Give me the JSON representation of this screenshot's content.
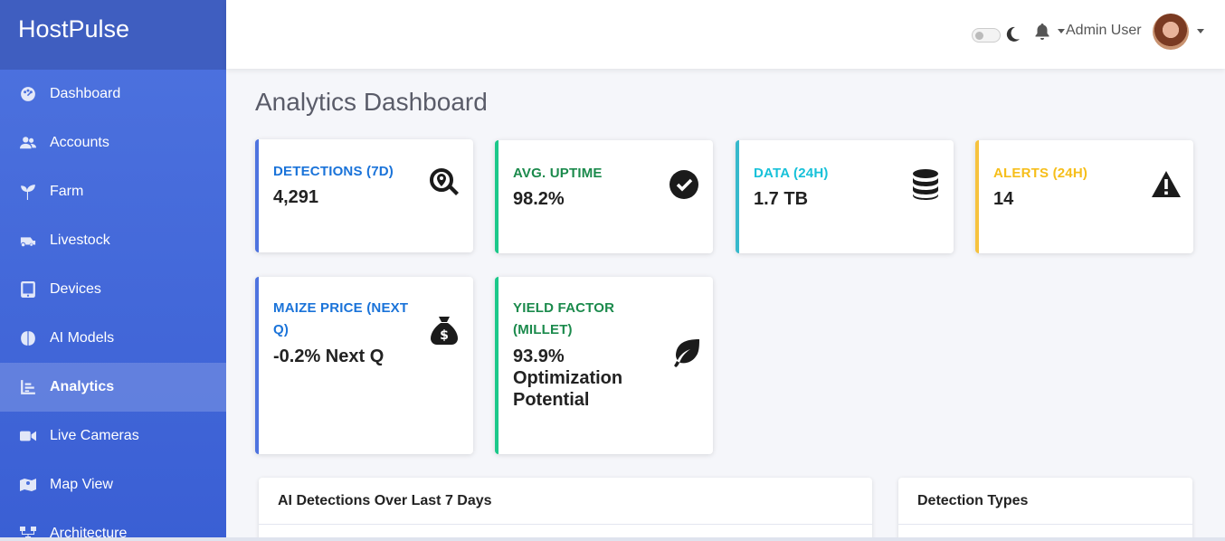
{
  "brand": {
    "name": "HostPulse"
  },
  "sidebar": {
    "items": [
      {
        "label": "Dashboard",
        "icon": "palette-icon",
        "active": false
      },
      {
        "label": "Accounts",
        "icon": "users-icon",
        "active": false
      },
      {
        "label": "Farm",
        "icon": "seedling-icon",
        "active": false
      },
      {
        "label": "Livestock",
        "icon": "tractor-icon",
        "active": false
      },
      {
        "label": "Devices",
        "icon": "tablet-icon",
        "active": false
      },
      {
        "label": "AI Models",
        "icon": "brain-icon",
        "active": false
      },
      {
        "label": "Analytics",
        "icon": "chart-icon",
        "active": true
      },
      {
        "label": "Live Cameras",
        "icon": "video-icon",
        "active": false
      },
      {
        "label": "Map View",
        "icon": "map-icon",
        "active": false
      },
      {
        "label": "Architecture",
        "icon": "sitemap-icon",
        "active": false
      }
    ]
  },
  "topbar": {
    "user_name": "Admin User"
  },
  "page": {
    "title": "Analytics Dashboard"
  },
  "cards": [
    {
      "label": "DETECTIONS (7D)",
      "value": "4,291",
      "color": "#1a73d9",
      "border": "#4e73df",
      "icon": "search-location-icon"
    },
    {
      "label": "AVG. UPTIME",
      "value": "98.2%",
      "color": "#1b8a4c",
      "border": "#1cc88a",
      "icon": "check-circle-icon"
    },
    {
      "label": "DATA (24H)",
      "value": "1.7 TB",
      "color": "#17c1d9",
      "border": "#36b9cc",
      "icon": "database-icon"
    },
    {
      "label": "ALERTS (24H)",
      "value": "14",
      "color": "#f6be1a",
      "border": "#f6c23e",
      "icon": "warning-icon"
    },
    {
      "label_line1": "MAIZE PRICE (NEXT",
      "label_line2": "Q)",
      "value": "-0.2% Next Q",
      "color": "#1a73d9",
      "border": "#4e73df",
      "icon": "money-bag-icon"
    },
    {
      "label_line1": "YIELD FACTOR",
      "label_line2": "(MILLET)",
      "value_line1": "93.9%",
      "value_line2": "Optimization",
      "value_line3": "Potential",
      "color": "#1b8a4c",
      "border": "#1cc88a",
      "icon": "leaf-icon"
    }
  ],
  "panels": {
    "detections_title": "AI Detections Over Last 7 Days",
    "types_title": "Detection Types"
  }
}
